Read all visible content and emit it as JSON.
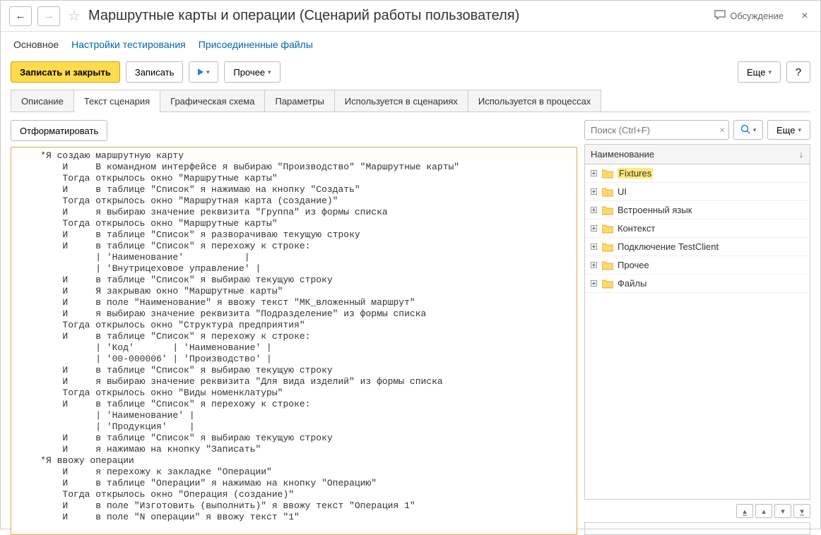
{
  "titlebar": {
    "title": "Маршрутные карты и операции (Сценарий работы пользователя)",
    "discuss_label": "Обсуждение",
    "star": "☆",
    "back": "←",
    "forward": "→",
    "close": "×"
  },
  "linkbar": {
    "main": "Основное",
    "settings": "Настройки тестирования",
    "files": "Присоединенные файлы"
  },
  "toolbar": {
    "write_close": "Записать и закрыть",
    "write": "Записать",
    "more_dd": "Прочее",
    "more": "Еще",
    "help": "?"
  },
  "tabs": [
    {
      "id": "desc",
      "label": "Описание"
    },
    {
      "id": "text",
      "label": "Текст сценария"
    },
    {
      "id": "graph",
      "label": "Графическая схема"
    },
    {
      "id": "params",
      "label": "Параметры"
    },
    {
      "id": "used_scen",
      "label": "Используется в сценариях"
    },
    {
      "id": "used_proc",
      "label": "Используется в процессах"
    }
  ],
  "format_btn": "Отформатировать",
  "editor_text": "    *Я создаю маршрутную карту\n        И     В командном интерфейсе я выбираю \"Производство\" \"Маршрутные карты\"\n        Тогда открылось окно \"Маршрутные карты\"\n        И     в таблице \"Список\" я нажимаю на кнопку \"Создать\"\n        Тогда открылось окно \"Маршрутная карта (создание)\"\n        И     я выбираю значение реквизита \"Группа\" из формы списка\n        Тогда открылось окно \"Маршрутные карты\"\n        И     в таблице \"Список\" я разворачиваю текущую строку\n        И     в таблице \"Список\" я перехожу к строке:\n              | 'Наименование'           |\n              | 'Внутрицеховое управление' |\n        И     в таблице \"Список\" я выбираю текущую строку\n        И     Я закрываю окно \"Маршрутные карты\"\n        И     в поле \"Наименование\" я ввожу текст \"МК_вложенный маршрут\"\n        И     я выбираю значение реквизита \"Подразделение\" из формы списка\n        Тогда открылось окно \"Структура предприятия\"\n        И     в таблице \"Список\" я перехожу к строке:\n              | 'Код'       | 'Наименование' |\n              | '00-000006' | 'Производство' |\n        И     в таблице \"Список\" я выбираю текущую строку\n        И     я выбираю значение реквизита \"Для вида изделий\" из формы списка\n        Тогда открылось окно \"Виды номенклатуры\"\n        И     в таблице \"Список\" я перехожу к строке:\n              | 'Наименование' |\n              | 'Продукция'    |\n        И     в таблице \"Список\" я выбираю текущую строку\n        И     я нажимаю на кнопку \"Записать\"\n    *Я ввожу операции\n        И     я перехожу к закладке \"Операции\"\n        И     в таблице \"Операции\" я нажимаю на кнопку \"Операцию\"\n        Тогда открылось окно \"Операция (создание)\"\n        И     в поле \"Изготовить (выполнить)\" я ввожу текст \"Операция 1\"\n        И     в поле \"N операции\" я ввожу текст \"1\"",
  "search": {
    "placeholder": "Поиск (Ctrl+F)"
  },
  "tree_header": "Наименование",
  "tree_items": [
    {
      "label": "Fixtures",
      "highlighted": true
    },
    {
      "label": "UI"
    },
    {
      "label": "Встроенный язык"
    },
    {
      "label": "Контекст"
    },
    {
      "label": "Подключение TestClient"
    },
    {
      "label": "Прочее"
    },
    {
      "label": "Файлы"
    }
  ],
  "chev_down": "▾"
}
